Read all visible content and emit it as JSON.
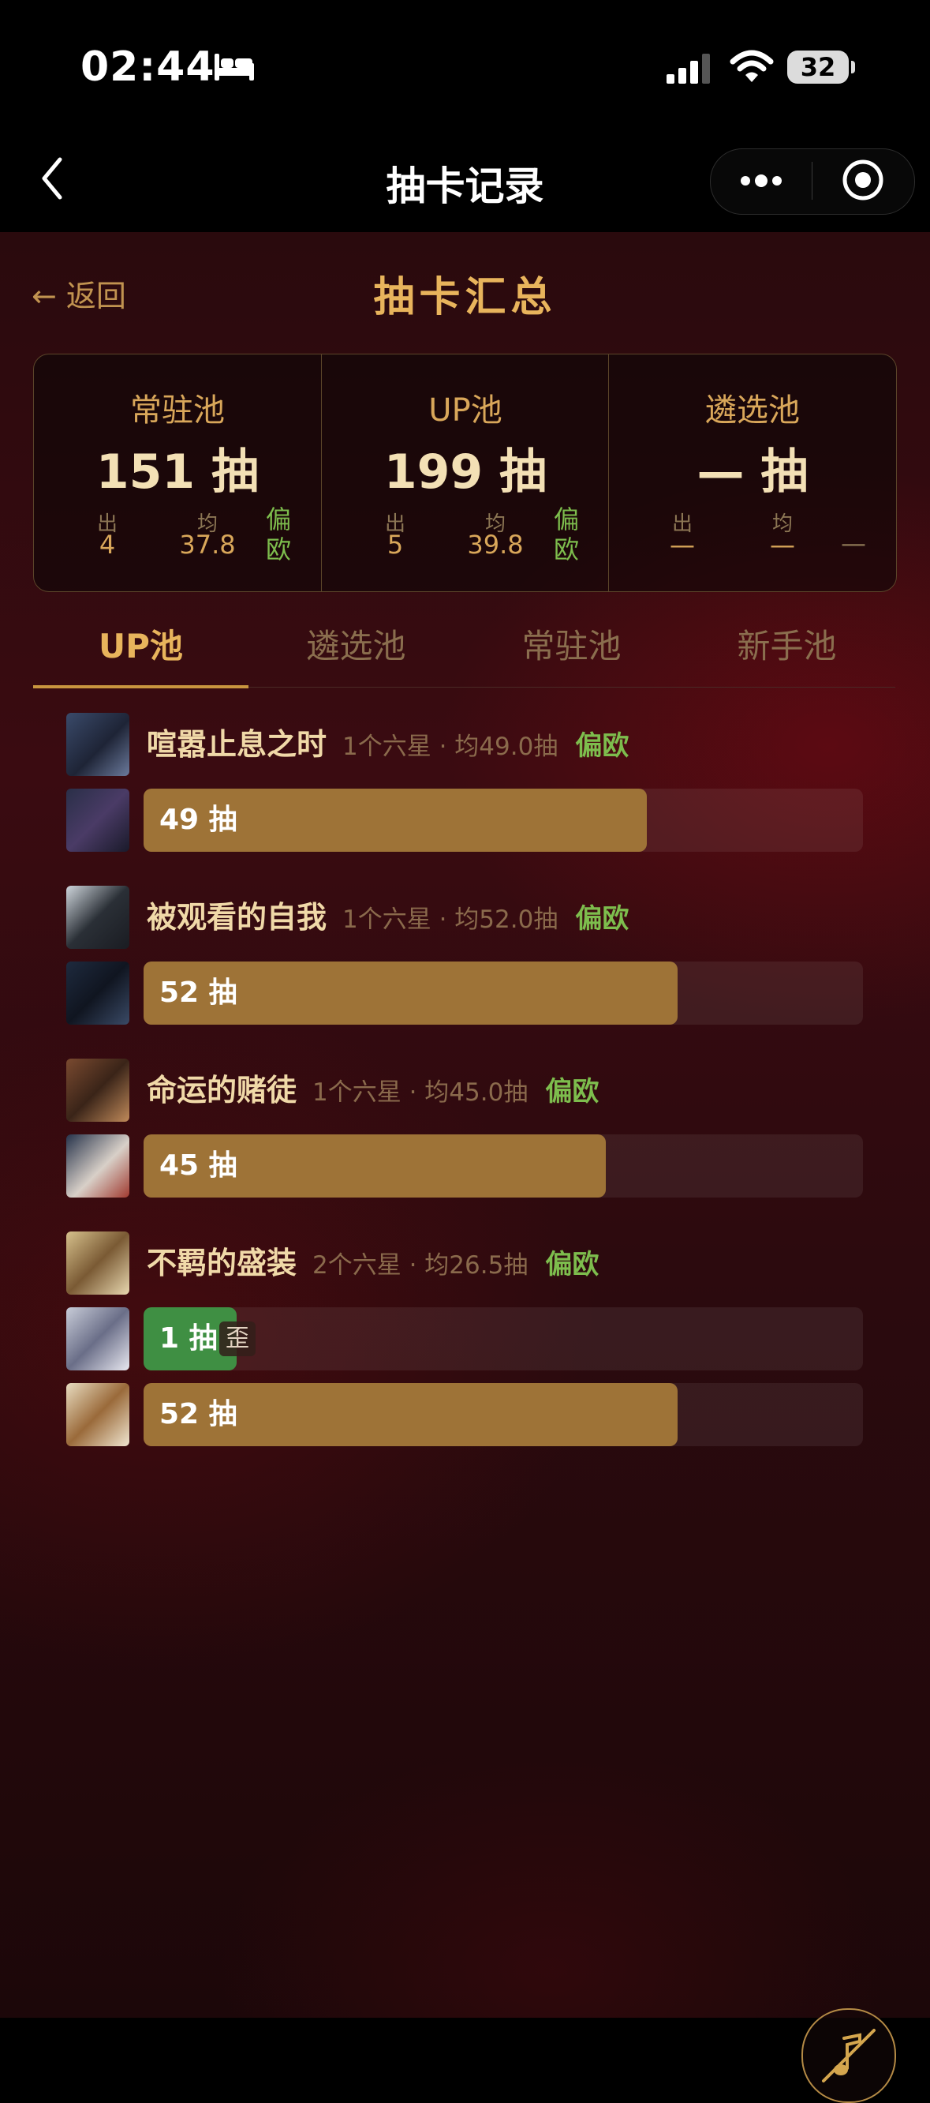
{
  "status_bar": {
    "time": "02:44",
    "battery": "32"
  },
  "nav": {
    "title": "抽卡记录"
  },
  "header": {
    "back_label": "← 返回",
    "title": "抽卡汇总"
  },
  "summary": [
    {
      "title": "常驻池",
      "count": "151 抽",
      "out_label": "出",
      "out_value": "4",
      "avg_label": "均",
      "avg_value": "37.8",
      "luck": "偏欧"
    },
    {
      "title": "UP池",
      "count": "199 抽",
      "out_label": "出",
      "out_value": "5",
      "avg_label": "均",
      "avg_value": "39.8",
      "luck": "偏欧"
    },
    {
      "title": "遴选池",
      "count": "— 抽",
      "out_label": "出",
      "out_value": "—",
      "avg_label": "均",
      "avg_value": "—",
      "luck": "—"
    }
  ],
  "tabs": [
    "UP池",
    "遴选池",
    "常驻池",
    "新手池"
  ],
  "active_tab": "UP池",
  "pools": [
    {
      "name": "喧嚣止息之时",
      "meta": "1个六星 · 均49.0抽",
      "luck": "偏欧",
      "pulls": [
        {
          "label": "49 抽",
          "value": 49
        }
      ]
    },
    {
      "name": "被观看的自我",
      "meta": "1个六星 · 均52.0抽",
      "luck": "偏欧",
      "pulls": [
        {
          "label": "52 抽",
          "value": 52
        }
      ]
    },
    {
      "name": "命运的赌徒",
      "meta": "1个六星 · 均45.0抽",
      "luck": "偏欧",
      "pulls": [
        {
          "label": "45 抽",
          "value": 45
        }
      ]
    },
    {
      "name": "不羁的盛装",
      "meta": "2个六星 · 均26.5抽",
      "luck": "偏欧",
      "pulls": [
        {
          "label": "1 抽",
          "value": 1,
          "tag": "歪"
        },
        {
          "label": "52 抽",
          "value": 52
        }
      ]
    }
  ],
  "colors": {
    "gold": "#e8b45c",
    "bar": "#9e7337",
    "bar_off_rate": "#3f8f43",
    "luck_green": "#7dbd4d"
  },
  "icons": [
    "bed-icon",
    "signal-icon",
    "wifi-icon",
    "battery-icon",
    "back-chevron-icon",
    "more-dots-icon",
    "target-icon",
    "music-off-icon"
  ]
}
